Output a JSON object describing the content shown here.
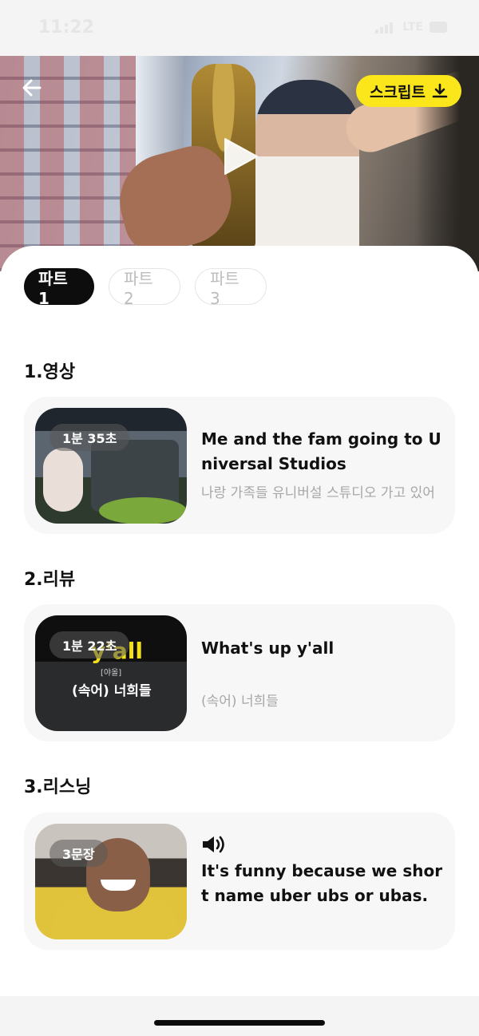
{
  "status_bar": {
    "time": "11:22",
    "network": "LTE"
  },
  "video": {
    "script_button_label": "스크립트"
  },
  "tabs": [
    {
      "label": "파트 1",
      "active": true
    },
    {
      "label": "파트 2",
      "active": false
    },
    {
      "label": "파트 3",
      "active": false
    }
  ],
  "sections": [
    {
      "title": "1.영상",
      "badge": "1분 35초",
      "card_title": "Me and the fam going to Universal Studios",
      "card_subtitle": "나랑 가족들 유니버설 스튜디오 가고 있어"
    },
    {
      "title": "2.리뷰",
      "badge": "1분 22초",
      "thumb_caption_big": "y'all",
      "thumb_caption_small": "[야올]",
      "thumb_caption_sub": "(속어) 너희들",
      "card_title": "What's up y'all",
      "card_subtitle": "(속어) 너희들"
    },
    {
      "title": "3.리스닝",
      "badge": "3문장",
      "card_title": "It's funny because we short name uber ubs or ubas."
    }
  ],
  "colors": {
    "accent_yellow": "#fbe61c",
    "active_tab": "#0d0d0d",
    "card_bg": "#f7f7f7"
  }
}
